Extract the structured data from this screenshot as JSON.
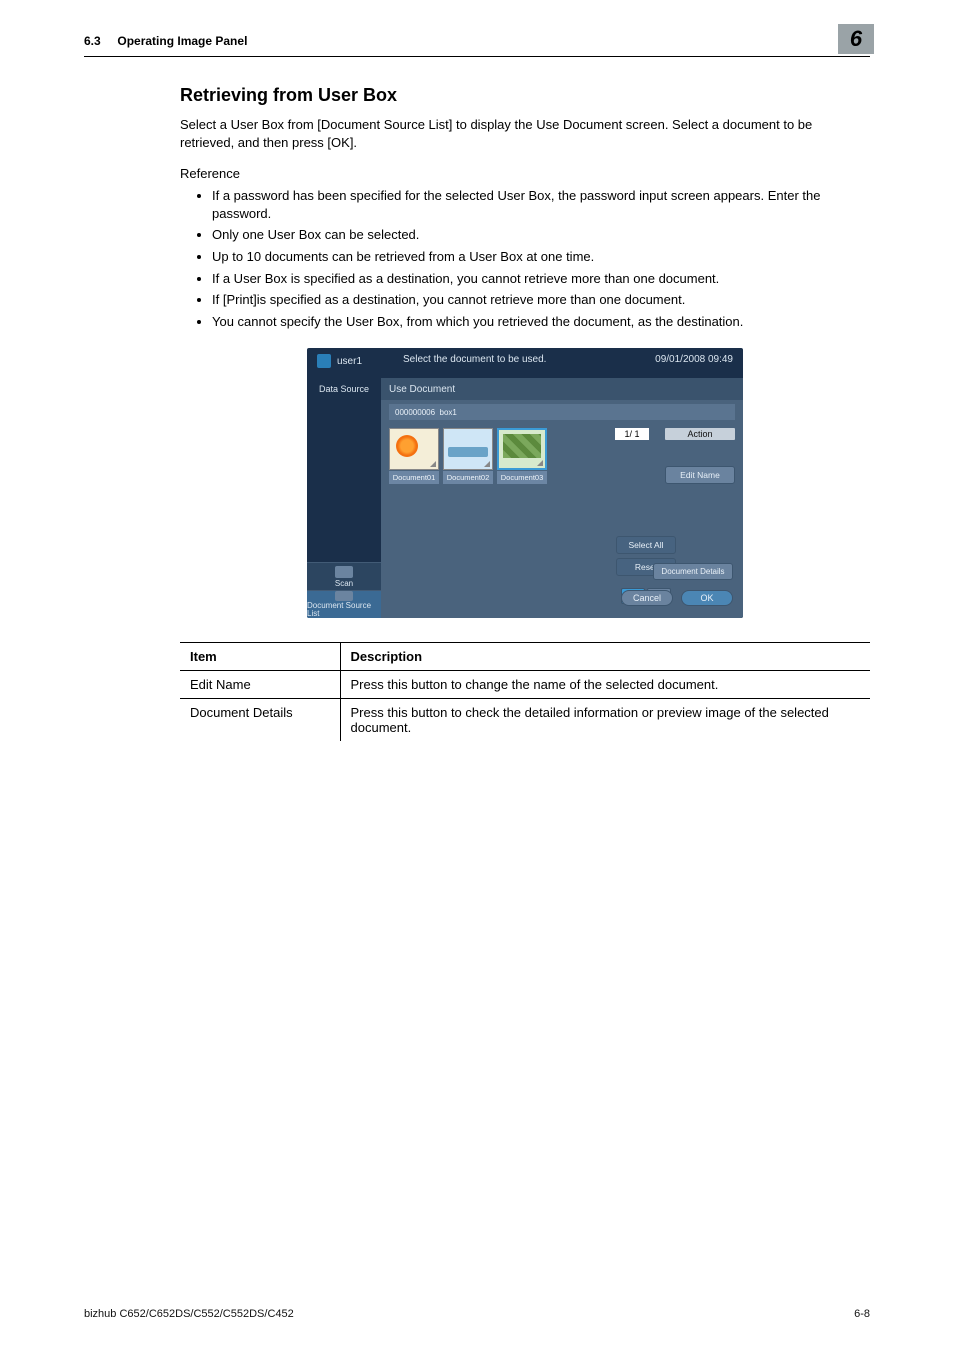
{
  "header": {
    "section": "6.3",
    "title": "Operating Image Panel",
    "chapter": "6"
  },
  "heading": "Retrieving from User Box",
  "lead": "Select a User Box from [Document Source List] to display the Use Document screen. Select a document to be retrieved, and then press [OK].",
  "reference_label": "Reference",
  "bullets": [
    "If a password has been specified for the selected User Box, the password input screen appears. Enter the password.",
    "Only one User Box can be selected.",
    "Up to 10 documents can be retrieved from a User Box at one time.",
    "If a User Box is specified as a destination, you cannot retrieve more than one document.",
    "If [Print]is specified as a destination, you cannot retrieve more than one document.",
    "You cannot specify the User Box, from which you retrieved the document, as the destination."
  ],
  "panel": {
    "user": "user1",
    "message": "Select the document to be used.",
    "datetime": "09/01/2008  09:49",
    "side_label": "Data Source",
    "side_scan": "Scan",
    "side_list": "Document Source List",
    "titlebar": "Use Document",
    "box_id": "000000006",
    "box_name": "box1",
    "docs": [
      "Document01",
      "Document02",
      "Document03"
    ],
    "pager": "1/  1",
    "action_header": "Action",
    "edit_name": "Edit Name",
    "doc_details": "Document Details",
    "select_all": "Select All",
    "reset": "Reset",
    "cancel": "Cancel",
    "ok": "OK"
  },
  "table": {
    "head_item": "Item",
    "head_desc": "Description",
    "rows": [
      {
        "item": "Edit Name",
        "desc": "Press this button to change the name of the selected document."
      },
      {
        "item": "Document Details",
        "desc": "Press this button to check the detailed information or preview image of the selected document."
      }
    ]
  },
  "footer": {
    "model": "bizhub C652/C652DS/C552/C552DS/C452",
    "page": "6-8"
  }
}
